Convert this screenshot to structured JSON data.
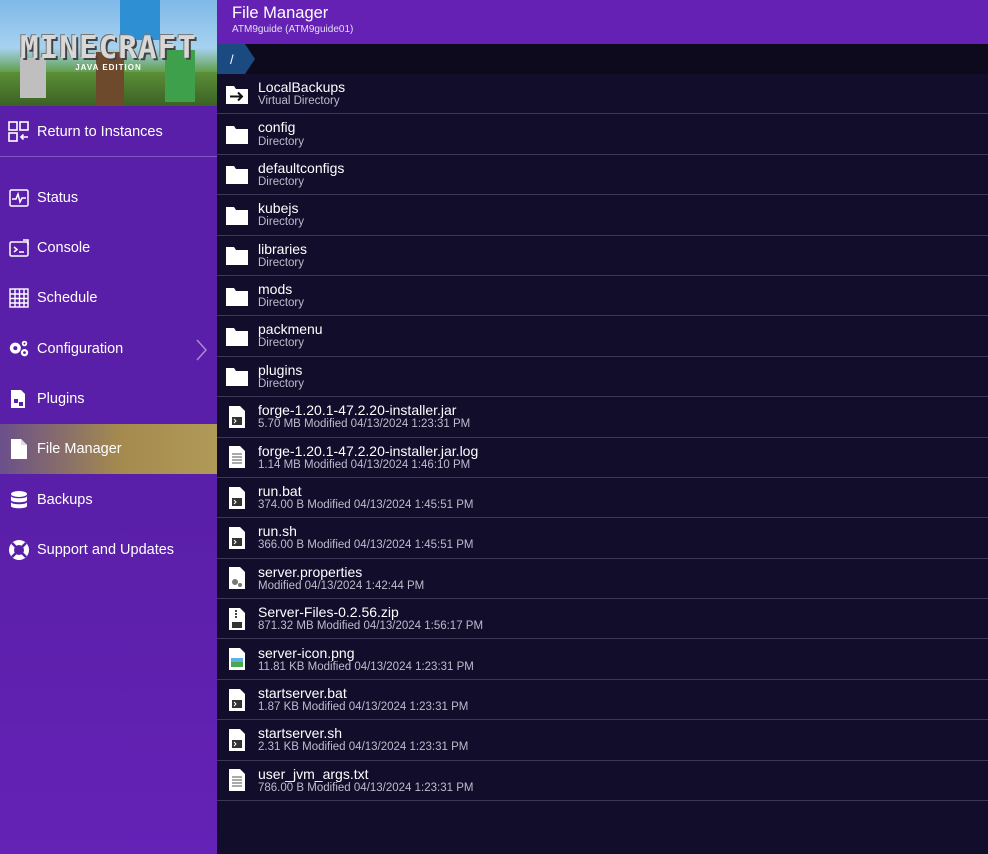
{
  "sidebar": {
    "logo_text": "MINECRAFT",
    "logo_sub": "JAVA EDITION",
    "return": {
      "label": "Return to Instances",
      "icon": "return-instances-icon"
    },
    "items": [
      {
        "label": "Status",
        "icon": "status-icon"
      },
      {
        "label": "Console",
        "icon": "console-icon"
      },
      {
        "label": "Schedule",
        "icon": "schedule-icon"
      },
      {
        "label": "Configuration",
        "icon": "gears-icon"
      },
      {
        "label": "Plugins",
        "icon": "plugins-icon"
      },
      {
        "label": "File Manager",
        "icon": "file-icon",
        "active": true
      },
      {
        "label": "Backups",
        "icon": "database-icon"
      },
      {
        "label": "Support and Updates",
        "icon": "lifebuoy-icon"
      }
    ],
    "active_gradient": [
      "#6a4f8a",
      "#b09a58"
    ]
  },
  "header": {
    "title": "File Manager",
    "subtitle": "ATM9guide (ATM9guide01)",
    "color": "#6421b3"
  },
  "breadcrumb": {
    "path": "/"
  },
  "files": [
    {
      "name": "LocalBackups",
      "meta": "Virtual Directory",
      "type": "virtual"
    },
    {
      "name": "config",
      "meta": "Directory",
      "type": "folder"
    },
    {
      "name": "defaultconfigs",
      "meta": "Directory",
      "type": "folder"
    },
    {
      "name": "kubejs",
      "meta": "Directory",
      "type": "folder"
    },
    {
      "name": "libraries",
      "meta": "Directory",
      "type": "folder"
    },
    {
      "name": "mods",
      "meta": "Directory",
      "type": "folder"
    },
    {
      "name": "packmenu",
      "meta": "Directory",
      "type": "folder"
    },
    {
      "name": "plugins",
      "meta": "Directory",
      "type": "folder"
    },
    {
      "name": "forge-1.20.1-47.2.20-installer.jar",
      "meta": "5.70 MB Modified 04/13/2024 1:23:31 PM",
      "type": "exec"
    },
    {
      "name": "forge-1.20.1-47.2.20-installer.jar.log",
      "meta": "1.14 MB Modified 04/13/2024 1:46:10 PM",
      "type": "text"
    },
    {
      "name": "run.bat",
      "meta": "374.00 B Modified 04/13/2024 1:45:51 PM",
      "type": "exec"
    },
    {
      "name": "run.sh",
      "meta": "366.00 B Modified 04/13/2024 1:45:51 PM",
      "type": "exec"
    },
    {
      "name": "server.properties",
      "meta": "Modified 04/13/2024 1:42:44 PM",
      "type": "config"
    },
    {
      "name": "Server-Files-0.2.56.zip",
      "meta": "871.32 MB Modified 04/13/2024 1:56:17 PM",
      "type": "zip"
    },
    {
      "name": "server-icon.png",
      "meta": "11.81 KB Modified 04/13/2024 1:23:31 PM",
      "type": "image"
    },
    {
      "name": "startserver.bat",
      "meta": "1.87 KB Modified 04/13/2024 1:23:31 PM",
      "type": "exec"
    },
    {
      "name": "startserver.sh",
      "meta": "2.31 KB Modified 04/13/2024 1:23:31 PM",
      "type": "exec"
    },
    {
      "name": "user_jvm_args.txt",
      "meta": "786.00 B Modified 04/13/2024 1:23:31 PM",
      "type": "text"
    }
  ]
}
